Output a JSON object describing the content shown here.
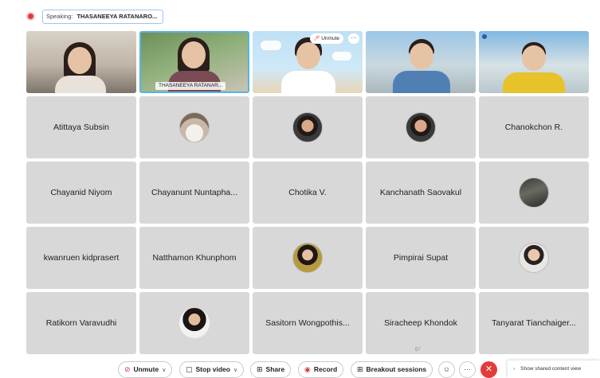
{
  "topbar": {
    "speaking_label": "Speaking:",
    "speaking_name": "THASANEEYA RATANARO..."
  },
  "video_row": {
    "tile2_name": "THASANEEYA RATANAR...",
    "tile3_unmute": "Unmute",
    "tile3_more": "···"
  },
  "participants": [
    "Atittaya Subsin",
    "Chanokchon R.",
    "Chayanid Niyom",
    "Chayanunt Nuntapha...",
    "Chotika V.",
    "Kanchanath Saovakul",
    "kwanruen kidprasert",
    "Natthamon Khunphom",
    "Pimpirai Supat",
    "Ratikorn Varavudhi",
    "Sasitorn Wongpothis...",
    "Siracheep Khondok",
    "Tanyarat Tianchaiger..."
  ],
  "controls": {
    "unmute": "Unmute",
    "stop_video": "Stop video",
    "share": "Share",
    "record": "Record",
    "breakout": "Breakout sessions",
    "more": "···",
    "leave": "✕"
  },
  "shared_content": "Show shared content view",
  "colors": {
    "accent_blue": "#56b4e8",
    "danger_red": "#e23c3c",
    "tile_gray": "#d8d8d8"
  },
  "icons": [
    "record-indicator-icon",
    "mic-muted-icon",
    "video-camera-icon",
    "share-icon",
    "record-icon",
    "breakout-icon",
    "reaction-icon",
    "close-icon",
    "chevron-right-icon"
  ]
}
